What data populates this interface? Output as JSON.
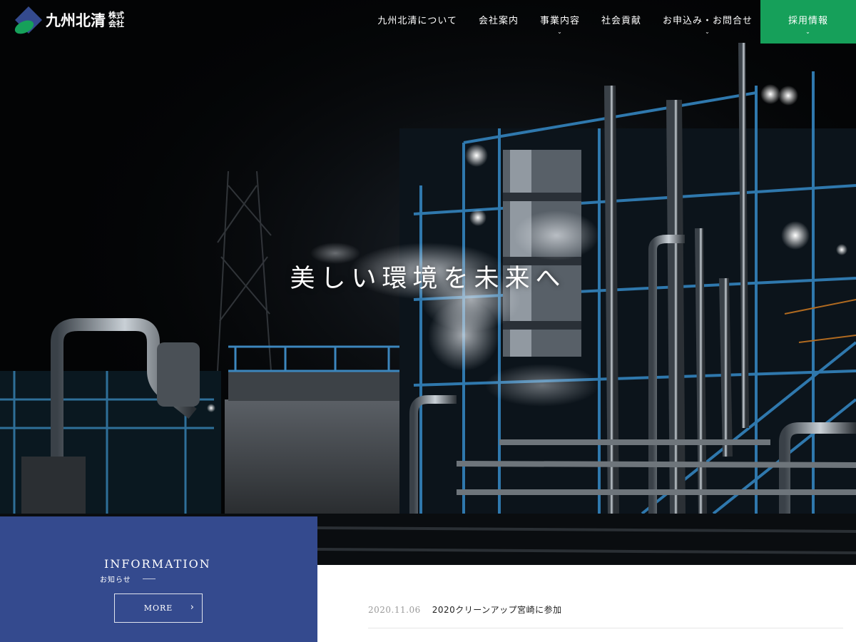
{
  "brand": {
    "name": "九州北清",
    "suffix_top": "株式",
    "suffix_bottom": "会社",
    "colors": {
      "logo_blue": "#344a8e",
      "logo_green": "#16a05a"
    }
  },
  "nav": {
    "items": [
      {
        "label": "九州北清について",
        "has_dropdown": false
      },
      {
        "label": "会社案内",
        "has_dropdown": false
      },
      {
        "label": "事業内容",
        "has_dropdown": true
      },
      {
        "label": "社会貢献",
        "has_dropdown": false
      },
      {
        "label": "お申込み・お問合せ",
        "has_dropdown": true
      }
    ],
    "recruit": {
      "label": "採用情報",
      "has_dropdown": true,
      "color": "#16a05a"
    },
    "chevron_icon": "chevron-down-icon",
    "chevron_glyph": "⌄"
  },
  "hero": {
    "tagline": "美しい環境を未来へ"
  },
  "information": {
    "title": "INFORMATION",
    "subtitle": "お知らせ",
    "more_label": "MORE",
    "more_arrow": "›",
    "panel_color": "#344a8e"
  },
  "news": {
    "items": [
      {
        "date": "2020.11.06",
        "title": "2020クリーンアップ宮崎に参加"
      }
    ]
  }
}
